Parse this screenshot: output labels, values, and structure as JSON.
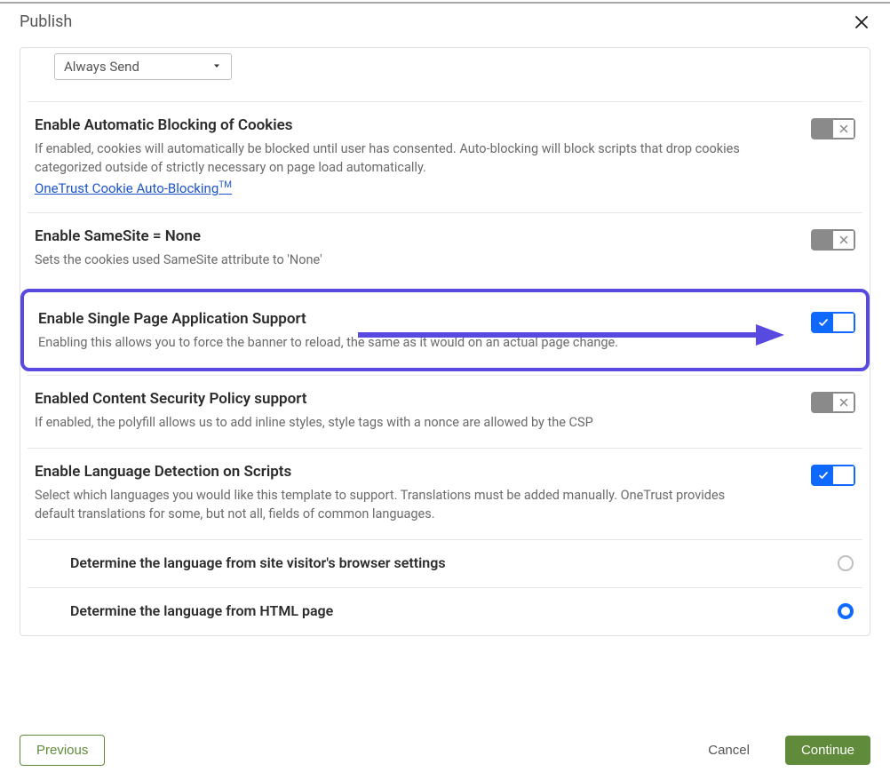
{
  "modal": {
    "title": "Publish"
  },
  "select": {
    "value": "Always Send"
  },
  "settings": {
    "autoblock": {
      "title": "Enable Automatic Blocking of Cookies",
      "desc": "If enabled, cookies will automatically be blocked until user has consented. Auto-blocking will block scripts that drop cookies categorized outside of strictly necessary on page load automatically.",
      "link_text": "OneTrust Cookie Auto-Blocking",
      "link_sup": "TM",
      "on": false
    },
    "samesite": {
      "title": "Enable SameSite = None",
      "desc": "Sets the cookies used SameSite attribute to 'None'",
      "on": false
    },
    "spa": {
      "title": "Enable Single Page Application Support",
      "desc": "Enabling this allows you to force the banner to reload, the same as it would on an actual page change.",
      "on": true
    },
    "csp": {
      "title": "Enabled Content Security Policy support",
      "desc": "If enabled, the polyfill allows us to add inline styles, style tags with a nonce are allowed by the CSP",
      "on": false
    },
    "lang": {
      "title": "Enable Language Detection on Scripts",
      "desc": "Select which languages you would like this template to support. Translations must be added manually. OneTrust provides default translations for some, but not all, fields of common languages.",
      "on": true,
      "options": {
        "browser": {
          "label": "Determine the language from site visitor's browser settings",
          "selected": false
        },
        "html": {
          "label": "Determine the language from HTML page",
          "selected": true
        }
      }
    }
  },
  "footer": {
    "previous": "Previous",
    "cancel": "Cancel",
    "continue": "Continue"
  }
}
